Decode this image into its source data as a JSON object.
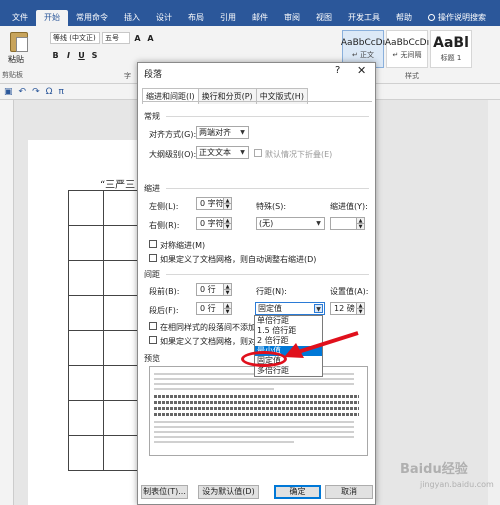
{
  "ribbon": {
    "tabs": [
      "文件",
      "开始",
      "常用命令",
      "插入",
      "设计",
      "布局",
      "引用",
      "邮件",
      "审阅",
      "视图",
      "开发工具",
      "帮助",
      "操作说明搜索"
    ],
    "active_tab": "开始",
    "paste_label": "粘贴",
    "clipboard_label": "剪贴板",
    "font_name": "等线 (中文正)",
    "font_size": "五号",
    "styles_label": "样式",
    "styles": [
      {
        "sample": "AaBbCcDı",
        "name": "↵ 正文"
      },
      {
        "sample": "AaBbCcDı",
        "name": "↵ 无间隔"
      },
      {
        "sample": "AaBl",
        "name": "标题 1"
      }
    ],
    "font_group_label": "字"
  },
  "document": {
    "title_fragment": "“三严三"
  },
  "dialog": {
    "title": "段落",
    "help": "?",
    "close": "✕",
    "tabs": [
      "缩进和间距(I)",
      "换行和分页(P)",
      "中文版式(H)"
    ],
    "general": {
      "section": "常规",
      "alignment_label": "对齐方式(G):",
      "alignment_value": "两端对齐",
      "outline_label": "大纲级别(O):",
      "outline_value": "正文文本",
      "collapsed_label": "默认情况下折叠(E)"
    },
    "indent": {
      "section": "缩进",
      "left_label": "左侧(L):",
      "left_value": "0 字符",
      "right_label": "右侧(R):",
      "right_value": "0 字符",
      "special_label": "特殊(S):",
      "special_value": "(无)",
      "by_label": "缩进值(Y):",
      "mirror_label": "对称缩进(M)",
      "grid_label": "如果定义了文档网格，则自动调整右缩进(D)"
    },
    "spacing": {
      "section": "间距",
      "before_label": "段前(B):",
      "before_value": "0 行",
      "after_label": "段后(F):",
      "after_value": "0 行",
      "line_label": "行距(N):",
      "line_value": "固定值",
      "at_label": "设置值(A):",
      "at_value": "12 磅",
      "no_space_label": "在相同样式的段落间不添加空",
      "snap_label": "如果定义了文档网格，则对齐"
    },
    "preview_label": "预览",
    "dropdown_options": [
      "单倍行距",
      "1.5 倍行距",
      "2 倍行距",
      "最小值",
      "固定值",
      "多倍行距"
    ],
    "dropdown_highlighted_index": 3,
    "buttons": {
      "tabs": "制表位(T)...",
      "default": "设为默认值(D)",
      "ok": "确定",
      "cancel": "取消"
    }
  },
  "watermark": {
    "text": "Baidu经验",
    "sub": "jingyan.baidu.com"
  },
  "colors": {
    "accent": "#2b579a",
    "highlight": "#0078d7",
    "annotation": "#e0101c"
  }
}
